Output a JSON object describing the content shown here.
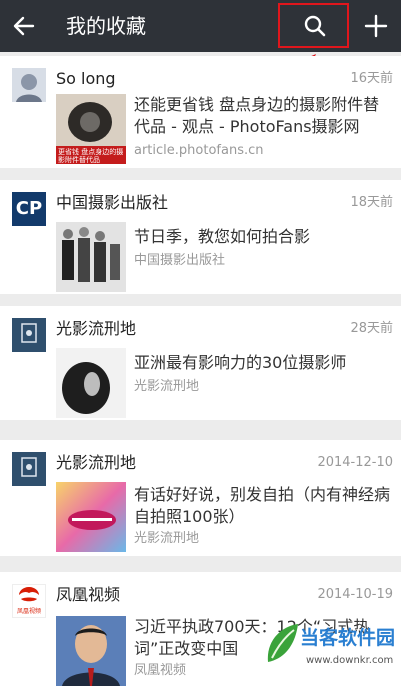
{
  "header": {
    "title": "我的收藏",
    "back_icon": "arrow-left-icon",
    "search_icon": "search-icon",
    "add_icon": "plus-icon"
  },
  "favorites": [
    {
      "source": "So long",
      "time": "16天前",
      "title": "还能更省钱 盘点身边的摄影附件替代品 - 观点 - PhotoFans摄影网",
      "subtitle": "article.photofans.cn",
      "thumb_caption": "更省钱 盘点身边的摄影附件替代品"
    },
    {
      "source": "中国摄影出版社",
      "time": "18天前",
      "title": "节日季，教您如何拍合影",
      "subtitle": "中国摄影出版社",
      "avatar_text": "CP"
    },
    {
      "source": "光影流刑地",
      "time": "28天前",
      "title": "亚洲最有影响力的30位摄影师",
      "subtitle": "光影流刑地"
    },
    {
      "source": "光影流刑地",
      "time": "2014-12-10",
      "title": "有话好好说，别发自拍（内有神经病自拍照100张）",
      "subtitle": "光影流刑地"
    },
    {
      "source": "凤凰视频",
      "time": "2014-10-19",
      "title": "习近平执政700天：12个“习式热词”正改变中国",
      "subtitle": "凤凰视频",
      "avatar_text": "凤凰视频"
    }
  ],
  "watermark": {
    "name": "当客软件园",
    "url": "www.downkr.com"
  },
  "colors": {
    "header_bg": "#2e3238",
    "highlight": "#e0161c"
  }
}
